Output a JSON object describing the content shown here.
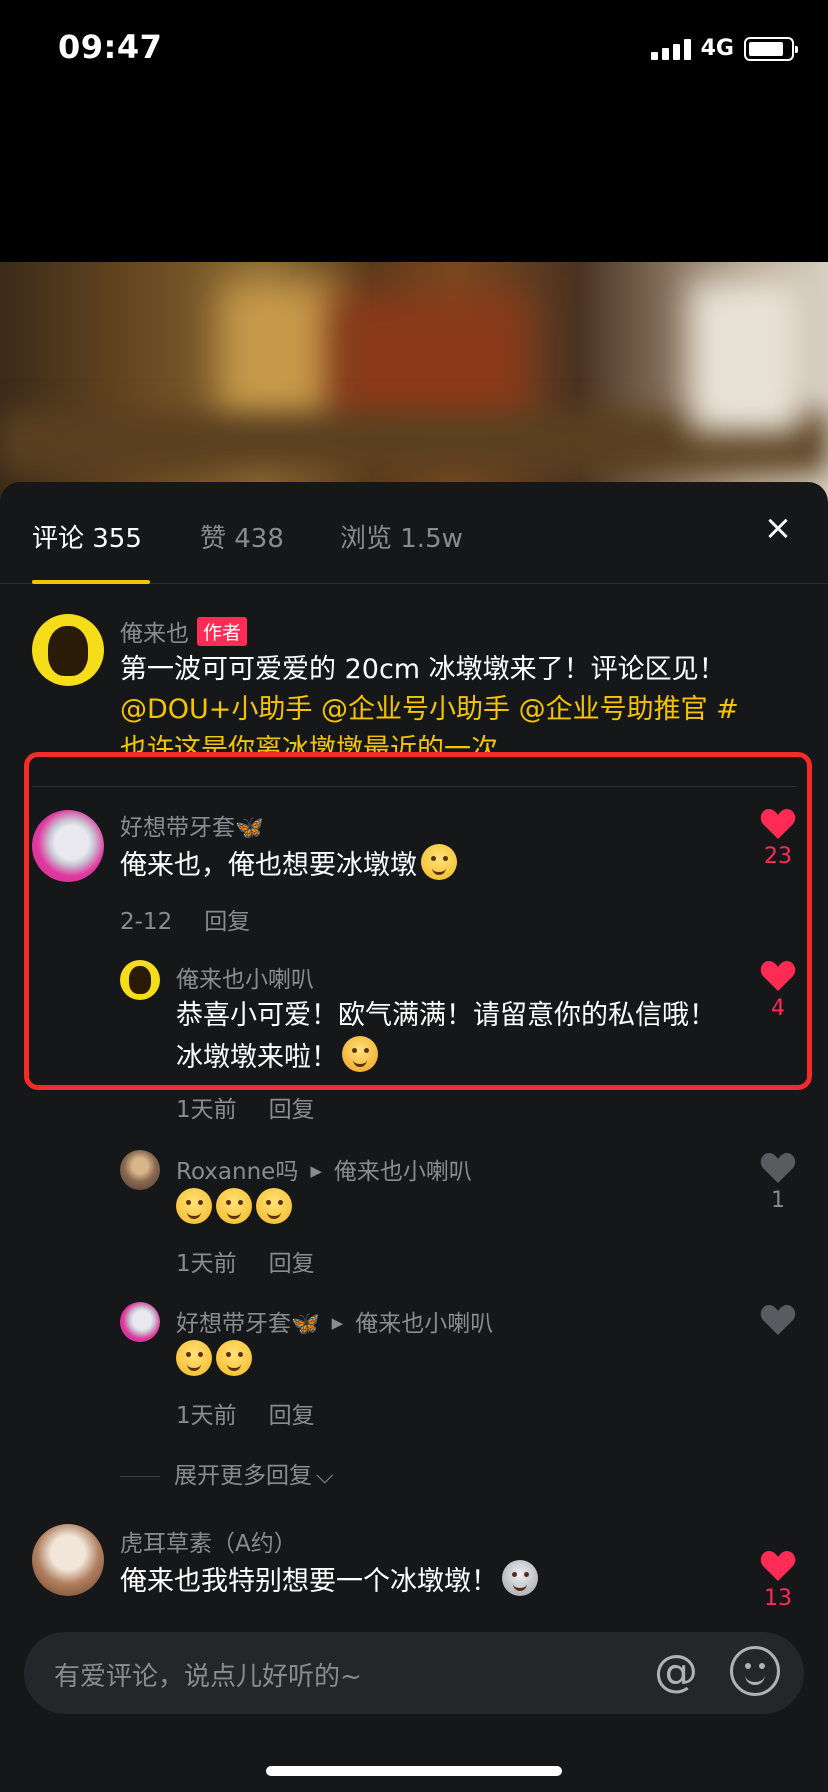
{
  "status_bar": {
    "time": "09:47",
    "network": "4G"
  },
  "tabs": [
    {
      "label": "评论 355",
      "active": true
    },
    {
      "label": "赞 438",
      "active": false
    },
    {
      "label": "浏览 1.5w",
      "active": false
    }
  ],
  "close_icon": "×",
  "comments": [
    {
      "user": "俺来也",
      "badge": "作者",
      "text_plain": "第一波可可爱爱的 20cm 冰墩墩来了！评论区见！",
      "text_mentions": "@DOU+小助手 @企业号小助手 @企业号助推官 #也许这是你离冰墩墩最近的一次"
    },
    {
      "user": "好想带牙套🦋",
      "text": "俺来也，俺也想要冰墩墩",
      "date": "2-12",
      "reply": "回复",
      "likes": "23"
    }
  ],
  "replies": [
    {
      "user": "俺来也小喇叭",
      "text": "恭喜小可爱！欧气满满！请留意你的私信哦！冰墩墩来啦！",
      "date": "1天前",
      "reply": "回复",
      "likes": "4"
    },
    {
      "user": "Roxanne吗",
      "reply_to": "俺来也小喇叭",
      "date": "1天前",
      "reply": "回复",
      "likes": "1"
    },
    {
      "user": "好想带牙套🦋",
      "reply_to": "俺来也小喇叭",
      "date": "1天前",
      "reply": "回复"
    }
  ],
  "expand_more": "展开更多回复",
  "expand_chevron": "⌵",
  "bottom_comment": {
    "user": "虎耳草素（A约）",
    "text": "俺来也我特别想要一个冰墩墩！",
    "likes": "13"
  },
  "input": {
    "placeholder": "有爱评论，说点儿好听的~",
    "at_symbol": "@"
  },
  "colors": {
    "accent": "#f5c400",
    "like": "#fe2c55",
    "highlight": "#f52a2a",
    "sheet_bg": "#161719"
  }
}
